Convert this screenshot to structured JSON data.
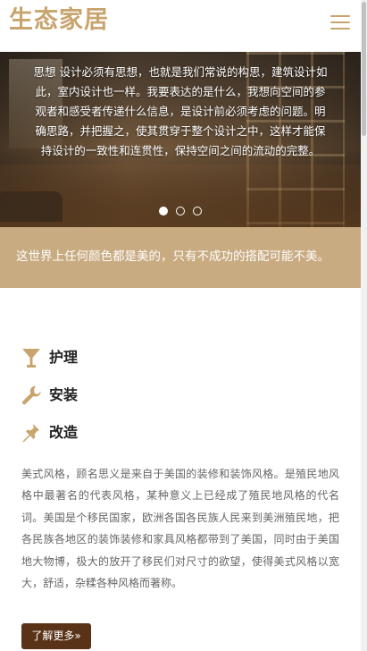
{
  "header": {
    "logo": "生态家居"
  },
  "hero": {
    "text": "思想 设计必须有思想，也就是我们常说的构思，建筑设计如此，室内设计也一样。我要表达的是什么，我想向空间的参观者和感受者传递什么信息，是设计前必须考虑的问题。明确思路，并把握之，使其贯穿于整个设计之中，这样才能保持设计的一致性和连贯性，保持空间之间的流动的完整。",
    "slides_total": 3,
    "active_slide": 1
  },
  "band": {
    "text": "这世界上任何颜色都是美的，只有不成功的搭配可能不美。"
  },
  "features": [
    {
      "label": "护理",
      "icon": "cocktail-glass-icon"
    },
    {
      "label": "安装",
      "icon": "wrench-icon"
    },
    {
      "label": "改造",
      "icon": "pushpin-icon"
    }
  ],
  "description": "美式风格，顾名思义是来自于美国的装修和装饰风格。是殖民地风格中最著名的代表风格，某种意义上已经成了殖民地风格的代名词。美国是个移民国家，欧洲各国各民族人民来到美洲殖民地，把各民族各地区的装饰装修和家具风格都带到了美国，同时由于美国地大物博，极大的放开了移民们对尺寸的欲望，使得美式风格以宽大，舒适，杂糅各种风格而著称。",
  "more_button": "了解更多»",
  "colors": {
    "accent": "#c8a46e",
    "band": "#c9ab82",
    "button": "#5a3217"
  }
}
